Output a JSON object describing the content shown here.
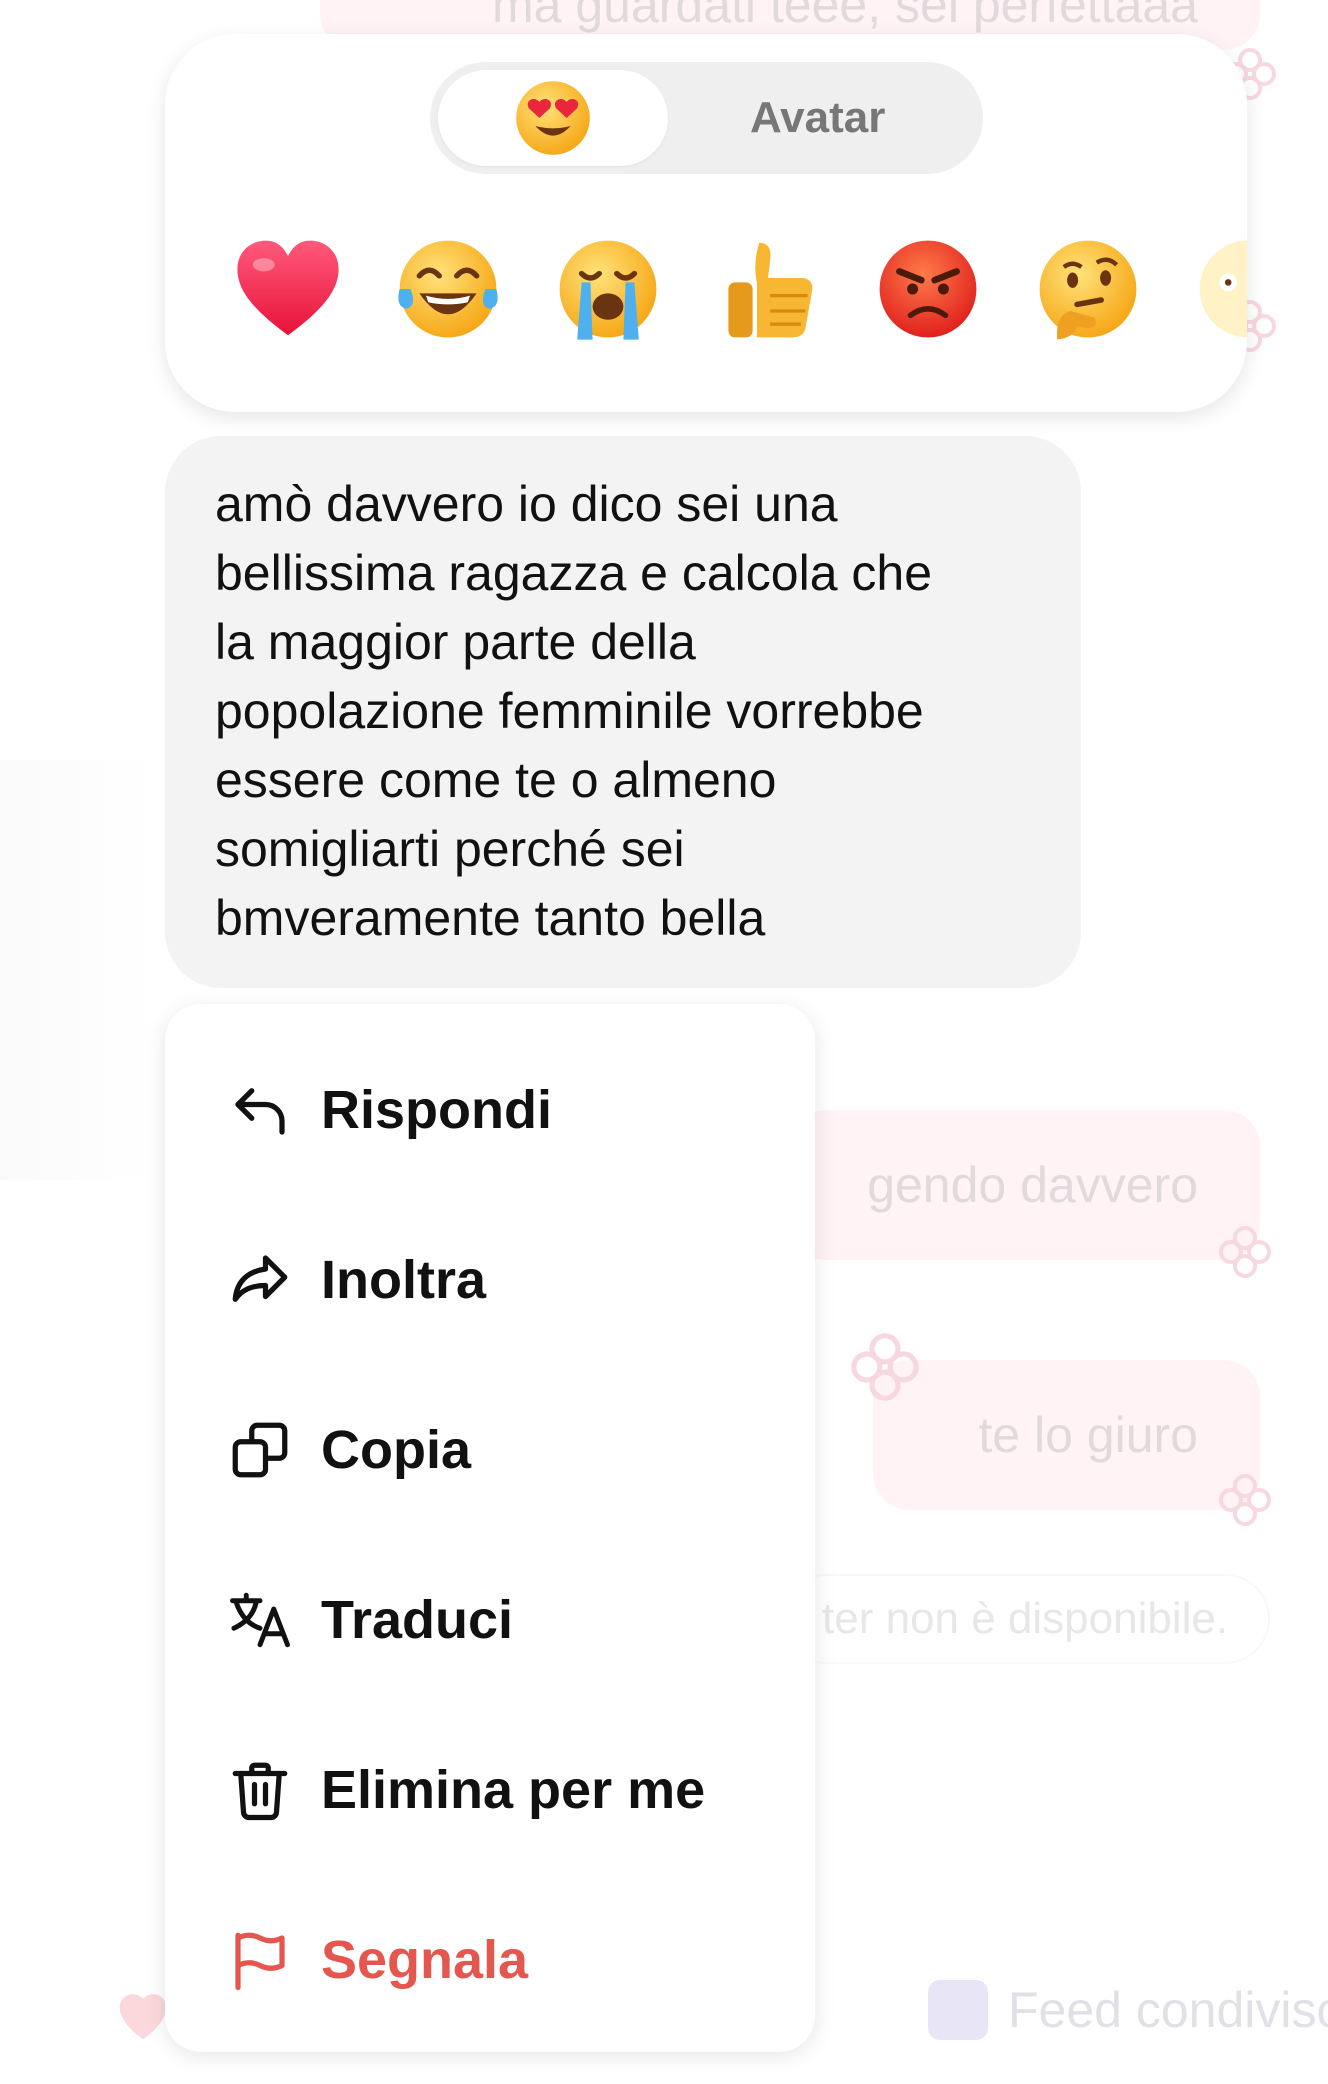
{
  "background_chat": {
    "top_message": "ma guardati teee, sei perfettaaa",
    "pink_message_1": "gendo davvero",
    "pink_message_2": "te lo giuro",
    "system_note": "ter non è disponibile.",
    "feed_label": "Feed condiviso"
  },
  "reaction_picker": {
    "tabs": [
      {
        "label": "",
        "icon": "heart-eyes-emoji",
        "selected": true
      },
      {
        "label": "Avatar",
        "selected": false
      }
    ],
    "reactions": [
      "red-heart",
      "tears-of-joy",
      "loudly-crying",
      "thumbs-up",
      "angry-face",
      "thinking-face",
      "partial-emoji"
    ]
  },
  "message": {
    "lines": [
      "amò davvero io dico sei una",
      "bellissima ragazza e calcola che",
      "la maggior parte della",
      "popolazione femminile vorrebbe",
      "essere come te o almeno",
      "somigliarti perché sei",
      "bmveramente tanto bella"
    ]
  },
  "menu": {
    "items": [
      {
        "label": "Rispondi",
        "icon": "reply-arrow-icon"
      },
      {
        "label": "Inoltra",
        "icon": "forward-arrow-icon"
      },
      {
        "label": "Copia",
        "icon": "copy-icon"
      },
      {
        "label": "Traduci",
        "icon": "translate-icon"
      },
      {
        "label": "Elimina per me",
        "icon": "trash-icon"
      },
      {
        "label": "Segnala",
        "icon": "flag-icon",
        "color": "#e3574f"
      }
    ]
  },
  "colors": {
    "danger": "#e3574f",
    "pink_bubble": "#ffe3e8",
    "message_bubble": "#f3f3f3"
  }
}
